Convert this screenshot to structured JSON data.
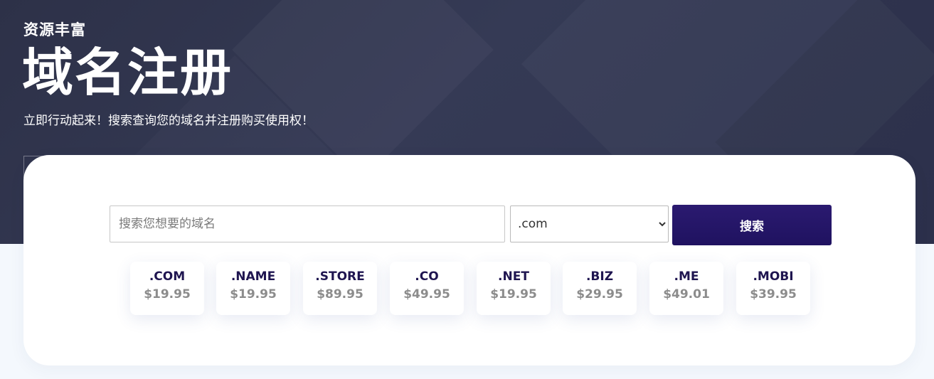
{
  "hero": {
    "eyebrow": "资源丰富",
    "title": "域名注册",
    "subtitle": "立即行动起来！搜索查询您的域名并注册购买使用权！"
  },
  "search": {
    "placeholder": "搜索您想要的域名",
    "value": "",
    "selected_tld": ".com",
    "button_label": "搜索"
  },
  "tlds": [
    {
      "name": ".COM",
      "price": "$19.95"
    },
    {
      "name": ".NAME",
      "price": "$19.95"
    },
    {
      "name": ".STORE",
      "price": "$89.95"
    },
    {
      "name": ".CO",
      "price": "$49.95"
    },
    {
      "name": ".NET",
      "price": "$19.95"
    },
    {
      "name": ".BIZ",
      "price": "$29.95"
    },
    {
      "name": ".ME",
      "price": "$49.01"
    },
    {
      "name": ".MOBI",
      "price": "$39.95"
    }
  ],
  "colors": {
    "hero_bg": "#2f3450",
    "accent_button": "#24156a",
    "tld_name": "#1f1550",
    "tld_price": "#8c8c8c"
  },
  "icons": {
    "select_arrow": "chevron-down-icon"
  }
}
